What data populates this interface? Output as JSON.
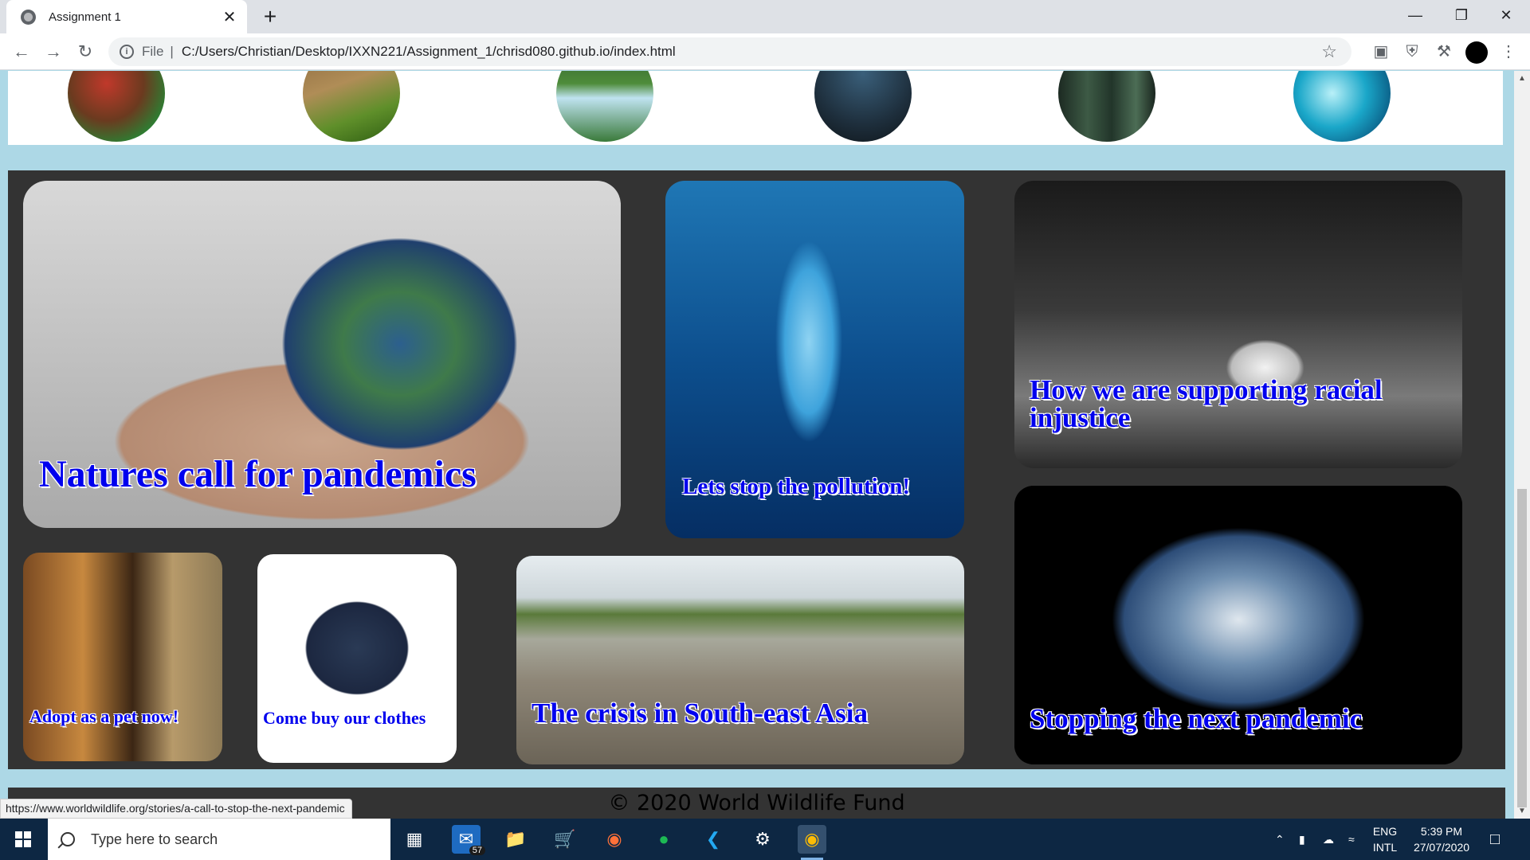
{
  "browser": {
    "tab_title": "Assignment 1",
    "tab_close": "✕",
    "new_tab": "+",
    "url_scheme_label": "File",
    "url_separator": "|",
    "url": "C:/Users/Christian/Desktop/IXXN221/Assignment_1/chrisd080.github.io/index.html",
    "status_url": "https://www.worldwildlife.org/stories/a-call-to-stop-the-next-pandemic"
  },
  "cards": {
    "natures_call": "Natures call for pandemics",
    "pollution": "Lets stop the pollution!",
    "racial": "How we are supporting racial injustice",
    "adopt": "Adopt as a pet now!",
    "clothes": "Come buy our clothes",
    "crisis": "The crisis in South-east Asia",
    "pandemic": "Stopping the next pandemic"
  },
  "footer": {
    "text": "© 2020 World Wildlife Fund"
  },
  "taskbar": {
    "search_placeholder": "Type here to search",
    "mail_badge": "57",
    "lang_top": "ENG",
    "lang_bottom": "INTL",
    "time": "5:39 PM",
    "date": "27/07/2020"
  },
  "colors": {
    "page_background": "#add8e6",
    "panel": "#333333",
    "link_text": "#0000ee",
    "taskbar": "#0d2743"
  }
}
